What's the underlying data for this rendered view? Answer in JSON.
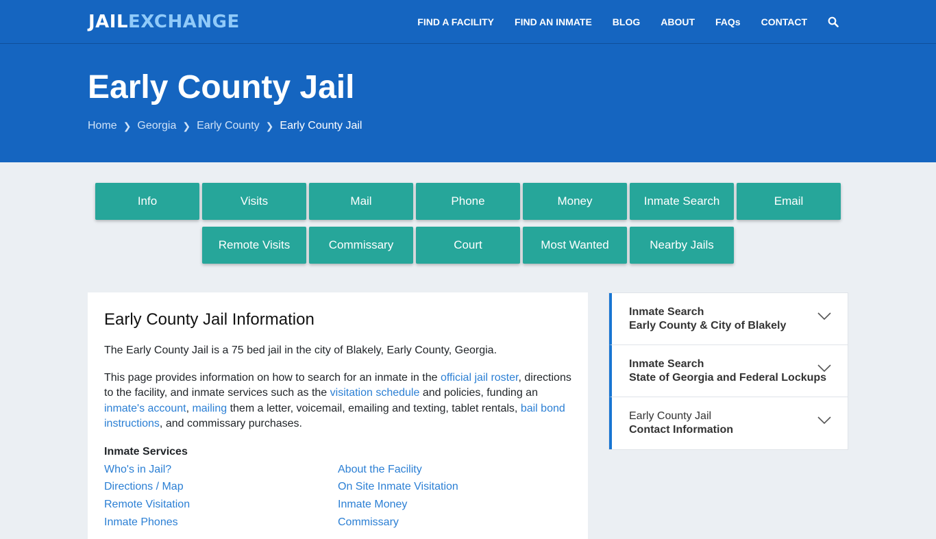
{
  "logo": {
    "part1": "JAIL",
    "part2": "EXCHANGE"
  },
  "nav": {
    "items": [
      "FIND A FACILITY",
      "FIND AN INMATE",
      "BLOG",
      "ABOUT",
      "FAQs",
      "CONTACT"
    ],
    "search_icon": "search-icon"
  },
  "hero": {
    "title": "Early County Jail",
    "breadcrumb": [
      "Home",
      "Georgia",
      "Early County",
      "Early County Jail"
    ]
  },
  "buttons": {
    "row1": [
      "Info",
      "Visits",
      "Mail",
      "Phone",
      "Money",
      "Inmate Search",
      "Email"
    ],
    "row2": [
      "Remote Visits",
      "Commissary",
      "Court",
      "Most Wanted",
      "Nearby Jails"
    ]
  },
  "main": {
    "title": "Early County Jail Information",
    "intro": "The Early County Jail is a 75 bed jail in the city of Blakely, Early County, Georgia.",
    "p2": {
      "t1": "This page provides information on how to search for an inmate in the ",
      "l1": "official jail roster",
      "t2": ", directions to the facility, and inmate services such as the ",
      "l2": "visitation schedule",
      "t3": " and policies, funding an ",
      "l3": "inmate's account",
      "t4": ", ",
      "l4": "mailing",
      "t5": " them a letter, voicemail, emailing and texting, tablet rentals, ",
      "l5": "bail bond instructions",
      "t6": ", and commissary purchases."
    },
    "services_heading": "Inmate Services",
    "services_left": [
      "Who's in Jail?",
      "Directions / Map",
      "Remote Visitation",
      "Inmate Phones"
    ],
    "services_right": [
      "About the Facility",
      "On Site Inmate Visitation",
      "Inmate Money",
      "Commissary"
    ]
  },
  "sidebar": {
    "items": [
      {
        "line1": "Inmate Search",
        "line2": "Early County & City of Blakely"
      },
      {
        "line1": "Inmate Search",
        "line2": "State of Georgia and Federal Lockups"
      },
      {
        "line1": "Early County Jail",
        "line2": "Contact Information"
      }
    ]
  },
  "colors": {
    "brand_blue": "#1565c0",
    "button_teal": "#26a69a",
    "link_blue": "#2b7fd4"
  }
}
